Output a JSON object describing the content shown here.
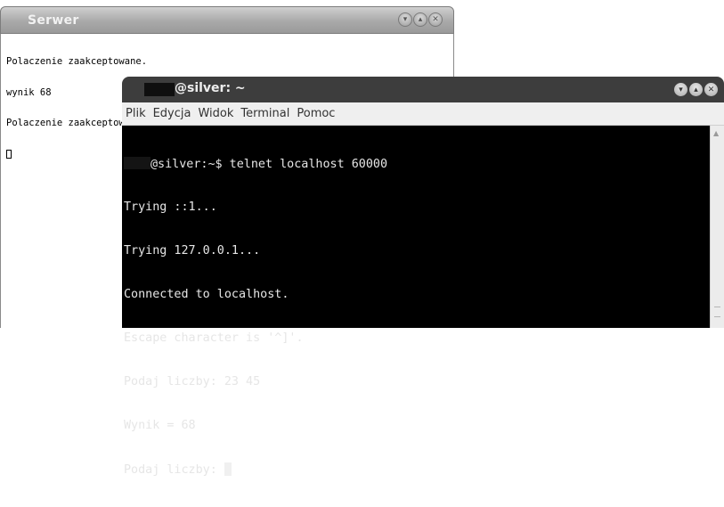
{
  "serwer_window": {
    "title": "Serwer",
    "lines": [
      "Polaczenie zaakceptowane.",
      "wynik 68",
      "Polaczenie zaakceptowane."
    ]
  },
  "terminal_window": {
    "title": "@silver: ~",
    "menu": [
      "Plik",
      "Edycja",
      "Widok",
      "Terminal",
      "Pomoc"
    ],
    "prompt_line": "@silver:~$ telnet localhost 60000",
    "lines": [
      "Trying ::1...",
      "Trying 127.0.0.1...",
      "Connected to localhost.",
      "Escape character is '^]'.",
      "Podaj liczby: 23 45",
      "Wynik = 68"
    ],
    "last_prompt": "Podaj liczby: "
  },
  "colors": {
    "terminal_bg": "#000000",
    "terminal_fg": "#e6e6e6",
    "titlebar_dark": "#3d3d3d"
  },
  "icons": [
    "minimize-icon",
    "maximize-icon",
    "close-icon",
    "scroll-up-arrow-icon"
  ]
}
